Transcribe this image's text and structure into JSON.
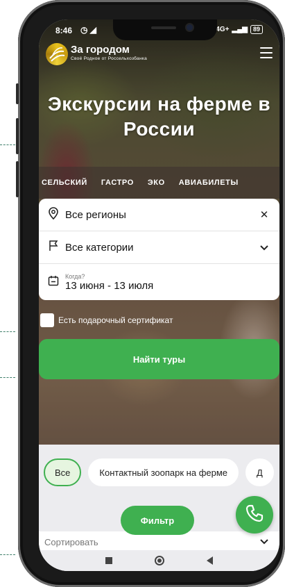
{
  "status_bar": {
    "time": "8:46",
    "left_icons": "◷ ◢",
    "network": "4G+",
    "battery": "89"
  },
  "header": {
    "brand_name": "За городом",
    "brand_tagline": "Своё Родное от Россельхозбанка"
  },
  "hero": {
    "title": "Экскурсии на ферме в России"
  },
  "tabs": [
    {
      "label": "СЕЛЬСКИЙ"
    },
    {
      "label": "ГАСТРО"
    },
    {
      "label": "ЭКО"
    },
    {
      "label": "АВИАБИЛЕТЫ"
    }
  ],
  "search": {
    "region": "Все регионы",
    "category": "Все категории",
    "when_label": "Когда?",
    "when_value": "13 июня - 13 июля",
    "gift_certificate": "Есть подарочный сертификат",
    "submit": "Найти туры"
  },
  "chips": [
    {
      "label": "Все",
      "active": true
    },
    {
      "label": "Контактный зоопарк на ферме",
      "active": false
    },
    {
      "label": "Д",
      "active": false
    }
  ],
  "filter_button": "Фильтр",
  "sort": {
    "label": "Сортировать"
  },
  "colors": {
    "accent": "#3fb050",
    "chip_active_bg": "#e6f5e0"
  }
}
